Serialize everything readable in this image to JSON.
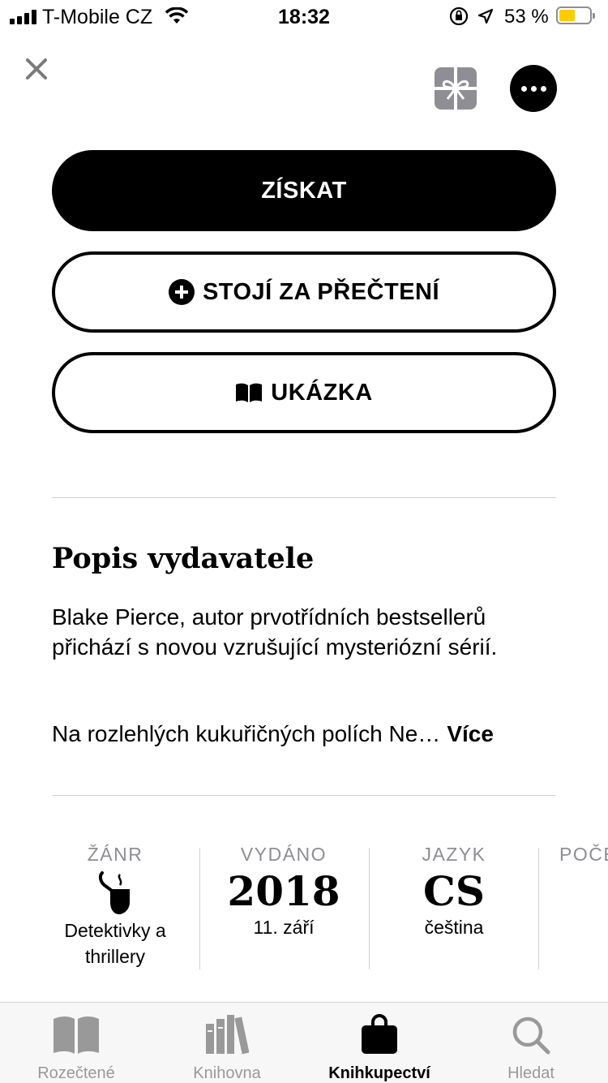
{
  "status_bar": {
    "carrier": "T-Mobile CZ",
    "time": "18:32",
    "battery_percent": "53 %",
    "battery_level": 0.53,
    "battery_color": "#ffcc00"
  },
  "header": {
    "close_icon": "close-icon",
    "gift_icon": "gift-icon",
    "more_icon": "more-icon"
  },
  "actions": {
    "get_label": "ZÍSKAT",
    "want_to_read_label": "STOJÍ ZA PŘEČTENÍ",
    "sample_label": "UKÁZKA"
  },
  "description": {
    "title": "Popis vydavatele",
    "paragraph1": "Blake Pierce, autor prvotřídních bestsellerů přichází s novou vzrušující mysteriózní sérií.",
    "paragraph2": "Na rozlehlých kukuřičných polích Ne…",
    "more_label": "Více"
  },
  "info": {
    "genre": {
      "label": "ŽÁNR",
      "icon": "detective-pipe-icon",
      "value": "Detektivky a thrillery"
    },
    "released": {
      "label": "VYDÁNO",
      "big": "2018",
      "sub": "11. září"
    },
    "language": {
      "label": "JAZYK",
      "big": "CS",
      "sub": "čeština"
    },
    "pages": {
      "label": "POČE"
    }
  },
  "tabs": [
    {
      "label": "Rozečtené",
      "icon": "open-book-icon",
      "active": false
    },
    {
      "label": "Knihovna",
      "icon": "library-icon",
      "active": false
    },
    {
      "label": "Knihkupectví",
      "icon": "shopping-bag-icon",
      "active": true
    },
    {
      "label": "Hledat",
      "icon": "search-icon",
      "active": false
    }
  ]
}
